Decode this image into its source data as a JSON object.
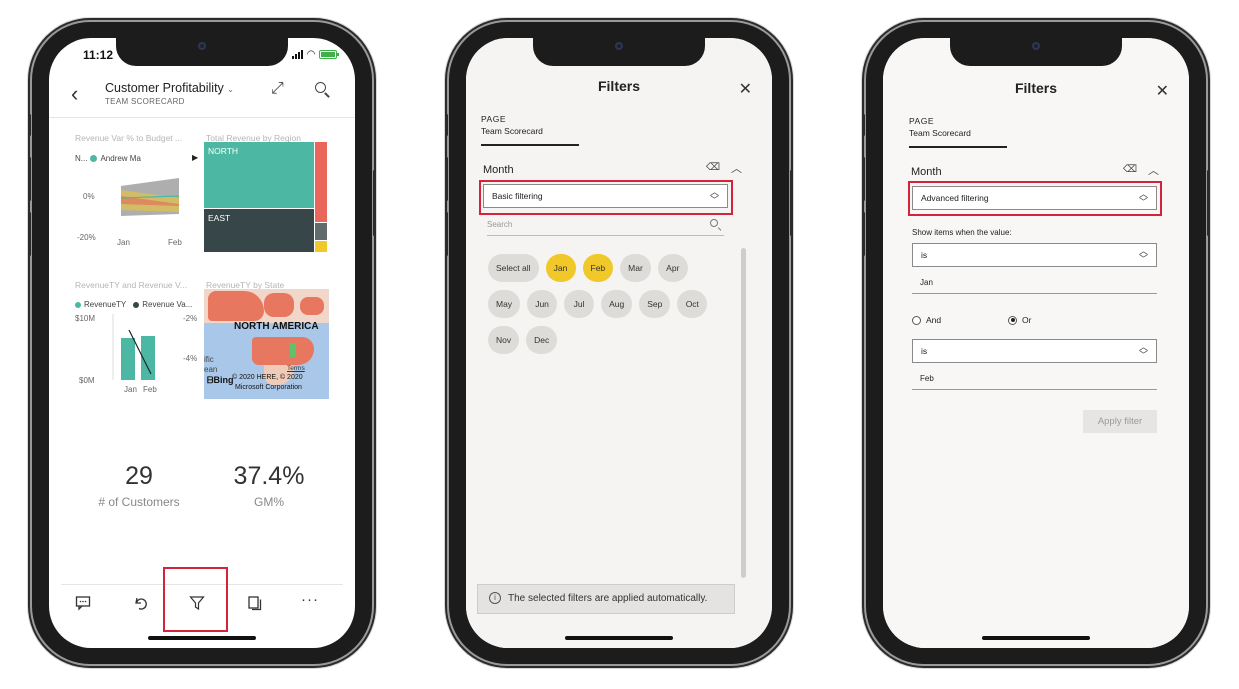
{
  "report": {
    "status_time": "11:12",
    "title": "Customer Profitability",
    "subtitle": "TEAM SCORECARD",
    "tiles": {
      "revenue_var_title": "Revenue Var % to Budget ...",
      "revenue_var_legend_n": "N...",
      "revenue_var_legend_name": "Andrew Ma",
      "revenue_var_y_top": "0%",
      "revenue_var_y_bottom": "-20%",
      "revenue_var_x1": "Jan",
      "revenue_var_x2": "Feb",
      "region_title": "Total Revenue by Region",
      "region_north": "NORTH",
      "region_east": "EAST",
      "revty_title": "RevenueTY and Revenue V...",
      "revty_legend_1": "RevenueTY",
      "revty_legend_2": "Revenue Va...",
      "revty_y_top": "$10M",
      "revty_y_bottom": "$0M",
      "revty_y2_top": "-2%",
      "revty_y2_bottom": "-4%",
      "revty_x1": "Jan",
      "revty_x2": "Feb",
      "state_title": "RevenueTY by State",
      "map_label": "NORTH AMERICA",
      "map_fragment_1": "ific",
      "map_fragment_2": "ean",
      "map_terms": "Terms",
      "map_bing": "Bing",
      "map_copyright_1": "© 2020 HERE, © 2020",
      "map_copyright_2": "Microsoft Corporation"
    },
    "kpis": [
      {
        "value": "29",
        "label": "# of Customers"
      },
      {
        "value": "37.4%",
        "label": "GM%"
      }
    ],
    "toolbar_more": "···"
  },
  "basic_filter": {
    "title": "Filters",
    "page_label": "PAGE",
    "page_name": "Team Scorecard",
    "field": "Month",
    "mode": "Basic filtering",
    "search_placeholder": "Search",
    "chips": [
      {
        "label": "Select all",
        "selected": false
      },
      {
        "label": "Jan",
        "selected": true
      },
      {
        "label": "Feb",
        "selected": true
      },
      {
        "label": "Mar",
        "selected": false
      },
      {
        "label": "Apr",
        "selected": false
      },
      {
        "label": "May",
        "selected": false
      },
      {
        "label": "Jun",
        "selected": false
      },
      {
        "label": "Jul",
        "selected": false
      },
      {
        "label": "Aug",
        "selected": false
      },
      {
        "label": "Sep",
        "selected": false
      },
      {
        "label": "Oct",
        "selected": false
      },
      {
        "label": "Nov",
        "selected": false
      },
      {
        "label": "Dec",
        "selected": false
      }
    ],
    "notice": "The selected filters are applied automatically."
  },
  "advanced_filter": {
    "title": "Filters",
    "page_label": "PAGE",
    "page_name": "Team Scorecard",
    "field": "Month",
    "mode": "Advanced filtering",
    "show_items_label": "Show items when the value:",
    "condition1_op": "is",
    "condition1_value": "Jan",
    "and_label": "And",
    "or_label": "Or",
    "logic_selected": "Or",
    "condition2_op": "is",
    "condition2_value": "Feb",
    "apply_label": "Apply filter"
  },
  "colors": {
    "teal": "#4cb8a4",
    "dark": "#374649",
    "red": "#e8675a",
    "yellow": "#f1c829",
    "highlight": "#d4243b"
  }
}
